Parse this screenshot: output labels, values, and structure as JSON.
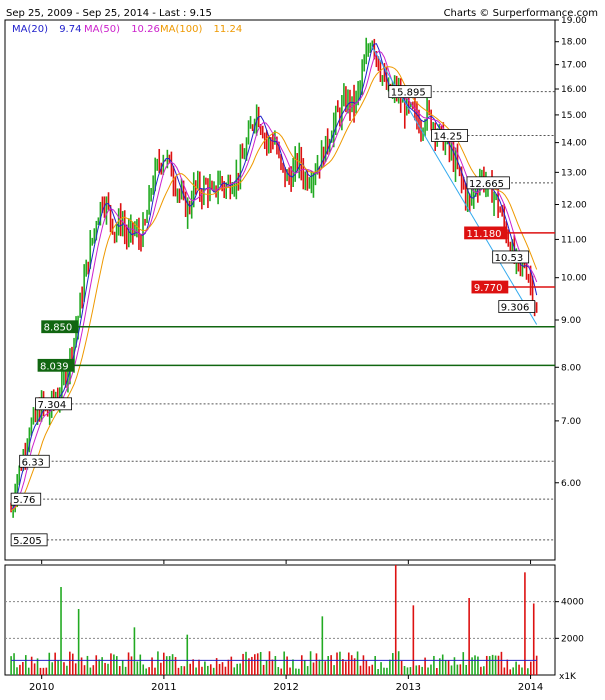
{
  "header": {
    "range": "Sep 25, 2009 - Sep 25, 2014 - Last : 9.15",
    "credit": "Charts © Surperformance.com"
  },
  "legend": [
    {
      "label": "MA(20)",
      "value": "9.74",
      "color": "#2222cc"
    },
    {
      "label": "MA(50)",
      "value": "10.26",
      "color": "#cc22cc"
    },
    {
      "label": "MA(100)",
      "value": "11.24",
      "color": "#ee9900"
    }
  ],
  "colors": {
    "up": "#22aa22",
    "down": "#dd1111",
    "volume_avg": "#2222cc",
    "trendline": "#33aaee",
    "level_dark": "#555555"
  },
  "chart_data": {
    "type": "line",
    "scale": "log",
    "price_ylim": [
      4.95,
      19.0
    ],
    "y_ticks": [
      6.0,
      7.0,
      8.0,
      9.0,
      10.0,
      11.0,
      12.0,
      13.0,
      14.0,
      15.0,
      16.0,
      17.0,
      18.0,
      19.0
    ],
    "y_tick_labels": [
      "6.00",
      "7.00",
      "8.00",
      "9.00",
      "10.00",
      "11.00",
      "12.00",
      "13.00",
      "14.00",
      "15.00",
      "16.00",
      "17.00",
      "18.00",
      "19.00"
    ],
    "x_ticks": [
      {
        "label": "2010",
        "t": 0.25
      },
      {
        "label": "2011",
        "t": 1.25
      },
      {
        "label": "2012",
        "t": 2.25
      },
      {
        "label": "2013",
        "t": 3.25
      },
      {
        "label": "2014",
        "t": 4.25
      }
    ],
    "price_path": [
      [
        0.0,
        5.6
      ],
      [
        0.05,
        6.1
      ],
      [
        0.1,
        6.4
      ],
      [
        0.15,
        6.9
      ],
      [
        0.2,
        7.0
      ],
      [
        0.25,
        7.3
      ],
      [
        0.3,
        7.1
      ],
      [
        0.35,
        7.4
      ],
      [
        0.4,
        7.5
      ],
      [
        0.45,
        7.9
      ],
      [
        0.5,
        8.4
      ],
      [
        0.55,
        9.1
      ],
      [
        0.6,
        10.0
      ],
      [
        0.65,
        10.8
      ],
      [
        0.7,
        11.6
      ],
      [
        0.75,
        12.2
      ],
      [
        0.8,
        11.8
      ],
      [
        0.85,
        11.2
      ],
      [
        0.9,
        11.6
      ],
      [
        0.95,
        11.0
      ],
      [
        1.0,
        11.3
      ],
      [
        1.05,
        11.0
      ],
      [
        1.1,
        11.4
      ],
      [
        1.15,
        12.6
      ],
      [
        1.2,
        13.2
      ],
      [
        1.25,
        13.6
      ],
      [
        1.3,
        13.2
      ],
      [
        1.35,
        12.6
      ],
      [
        1.4,
        12.1
      ],
      [
        1.45,
        11.8
      ],
      [
        1.5,
        12.6
      ],
      [
        1.55,
        12.4
      ],
      [
        1.6,
        12.6
      ],
      [
        1.65,
        12.2
      ],
      [
        1.7,
        12.8
      ],
      [
        1.75,
        12.5
      ],
      [
        1.8,
        12.7
      ],
      [
        1.85,
        12.9
      ],
      [
        1.9,
        13.5
      ],
      [
        1.95,
        14.3
      ],
      [
        2.0,
        15.2
      ],
      [
        2.05,
        14.6
      ],
      [
        2.1,
        13.9
      ],
      [
        2.15,
        14.2
      ],
      [
        2.2,
        13.2
      ],
      [
        2.25,
        12.8
      ],
      [
        2.3,
        12.9
      ],
      [
        2.35,
        13.5
      ],
      [
        2.4,
        12.8
      ],
      [
        2.45,
        12.9
      ],
      [
        2.5,
        13.2
      ],
      [
        2.55,
        13.6
      ],
      [
        2.6,
        14.2
      ],
      [
        2.65,
        14.8
      ],
      [
        2.7,
        15.2
      ],
      [
        2.75,
        15.6
      ],
      [
        2.8,
        15.3
      ],
      [
        2.85,
        16.0
      ],
      [
        2.9,
        17.2
      ],
      [
        2.95,
        18.3
      ],
      [
        3.0,
        17.2
      ],
      [
        3.05,
        16.3
      ],
      [
        3.1,
        15.7
      ],
      [
        3.15,
        16.0
      ],
      [
        3.2,
        15.4
      ],
      [
        3.25,
        15.2
      ],
      [
        3.3,
        15.0
      ],
      [
        3.35,
        14.6
      ],
      [
        3.4,
        15.1
      ],
      [
        3.45,
        14.7
      ],
      [
        3.5,
        14.3
      ],
      [
        3.55,
        14.0
      ],
      [
        3.6,
        13.6
      ],
      [
        3.65,
        13.1
      ],
      [
        3.7,
        12.5
      ],
      [
        3.75,
        12.0
      ],
      [
        3.8,
        12.6
      ],
      [
        3.85,
        12.9
      ],
      [
        3.9,
        12.5
      ],
      [
        3.95,
        12.3
      ],
      [
        4.0,
        11.8
      ],
      [
        4.05,
        11.2
      ],
      [
        4.1,
        10.6
      ],
      [
        4.15,
        10.2
      ],
      [
        4.2,
        10.4
      ],
      [
        4.25,
        9.9
      ],
      [
        4.28,
        9.4
      ],
      [
        4.3,
        9.15
      ]
    ],
    "moving_averages": [
      {
        "name": "MA(20)",
        "color": "#2222cc",
        "lag": 0.06
      },
      {
        "name": "MA(50)",
        "color": "#cc22cc",
        "lag": 0.12
      },
      {
        "name": "MA(100)",
        "color": "#ee9900",
        "lag": 0.24
      }
    ],
    "levels": [
      {
        "value": 15.895,
        "label": "15.895",
        "style": "dashed",
        "label_t": 3.09
      },
      {
        "value": 14.25,
        "label": "14.25",
        "style": "dashed",
        "label_t": 3.44
      },
      {
        "value": 12.665,
        "label": "12.665",
        "style": "dashed",
        "label_t": 3.73
      },
      {
        "value": 11.18,
        "label": "11.180",
        "style": "solid-red",
        "label_t": 3.71
      },
      {
        "value": 10.53,
        "label": "10.53",
        "style": "none",
        "label_t": 3.94
      },
      {
        "value": 9.77,
        "label": "9.770",
        "style": "solid-red",
        "label_t": 3.77
      },
      {
        "value": 9.306,
        "label": "9.306",
        "style": "none",
        "label_t": 3.99
      },
      {
        "value": 8.85,
        "label": "8.850",
        "style": "solid-green",
        "label_t": 0.25
      },
      {
        "value": 8.039,
        "label": "8.039",
        "style": "solid-green",
        "label_t": 0.22
      },
      {
        "value": 7.304,
        "label": "7.304",
        "style": "dashed",
        "label_t": 0.2
      },
      {
        "value": 6.33,
        "label": "6.33",
        "style": "dashed",
        "label_t": 0.07
      },
      {
        "value": 5.76,
        "label": "5.76",
        "style": "dashed",
        "label_t": 0.0
      },
      {
        "value": 5.205,
        "label": "5.205",
        "style": "dashed",
        "label_t": 0.0
      }
    ],
    "trendline": [
      [
        2.95,
        17.8
      ],
      [
        4.3,
        8.9
      ]
    ],
    "volume": {
      "ylim": [
        0,
        6000
      ],
      "y_ticks": [
        2000,
        4000
      ],
      "y_tick_labels": [
        "2000",
        "4000"
      ],
      "unit_label": "x1K",
      "spikes": [
        {
          "t": 0.4,
          "v": 4800
        },
        {
          "t": 0.55,
          "v": 3600
        },
        {
          "t": 1.0,
          "v": 2600
        },
        {
          "t": 1.45,
          "v": 2200
        },
        {
          "t": 2.55,
          "v": 3200
        },
        {
          "t": 3.15,
          "v": 6000
        },
        {
          "t": 3.3,
          "v": 3800
        },
        {
          "t": 3.75,
          "v": 4200
        },
        {
          "t": 4.2,
          "v": 5600
        },
        {
          "t": 4.28,
          "v": 3900
        }
      ],
      "avg_level": 800
    }
  }
}
